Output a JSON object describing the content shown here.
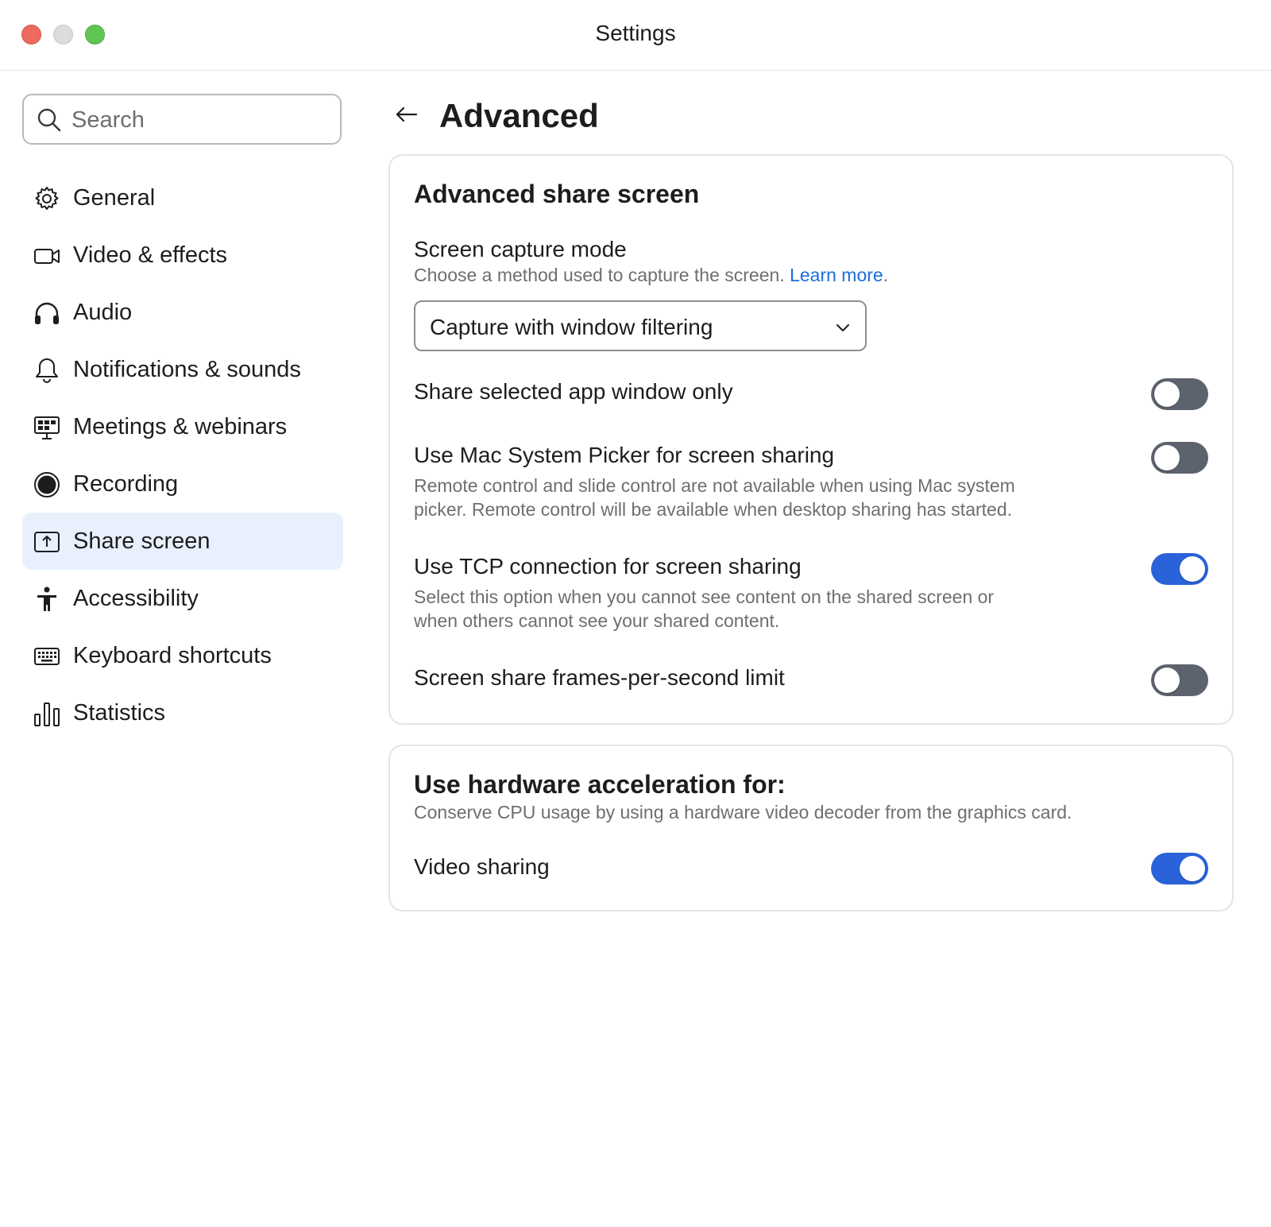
{
  "window": {
    "title": "Settings"
  },
  "search": {
    "placeholder": "Search"
  },
  "sidebar": {
    "items": [
      {
        "label": "General",
        "icon": "gear-icon",
        "active": false
      },
      {
        "label": "Video & effects",
        "icon": "video-camera-icon",
        "active": false
      },
      {
        "label": "Audio",
        "icon": "headphones-icon",
        "active": false
      },
      {
        "label": "Notifications & sounds",
        "icon": "bell-icon",
        "active": false
      },
      {
        "label": "Meetings & webinars",
        "icon": "meetings-icon",
        "active": false
      },
      {
        "label": "Recording",
        "icon": "record-icon",
        "active": false
      },
      {
        "label": "Share screen",
        "icon": "share-screen-icon",
        "active": true
      },
      {
        "label": "Accessibility",
        "icon": "accessibility-icon",
        "active": false
      },
      {
        "label": "Keyboard shortcuts",
        "icon": "keyboard-icon",
        "active": false
      },
      {
        "label": "Statistics",
        "icon": "bar-chart-icon",
        "active": false
      }
    ]
  },
  "main": {
    "title": "Advanced",
    "advanced_share": {
      "heading": "Advanced share screen",
      "capture_mode": {
        "title": "Screen capture mode",
        "description": "Choose a method used to capture the screen.",
        "link": "Learn more",
        "link_suffix": ".",
        "selected": "Capture with window filtering"
      },
      "share_app_window": {
        "title": "Share selected app window only",
        "on": false
      },
      "mac_picker": {
        "title": "Use Mac System Picker for screen sharing",
        "desc_line1": "Remote control and slide control are not available when using Mac system",
        "desc_line2": "picker. Remote control will be available when desktop sharing has started.",
        "on": false
      },
      "tcp": {
        "title": "Use TCP connection for screen sharing",
        "desc_line1": "Select this option when you cannot see content on the shared screen or",
        "desc_line2": "when others cannot see your shared content.",
        "on": true
      },
      "fps_limit": {
        "title": "Screen share frames-per-second limit",
        "on": false
      }
    },
    "hardware": {
      "heading": "Use hardware acceleration for:",
      "description": "Conserve CPU usage by using a hardware video decoder from the graphics card.",
      "video_sharing": {
        "title": "Video sharing",
        "on": true
      }
    }
  },
  "colors": {
    "accent": "#2a62d9",
    "link": "#1a6ddc",
    "toggle_off": "#5d636e",
    "active_nav_bg": "#e8f0fd"
  }
}
